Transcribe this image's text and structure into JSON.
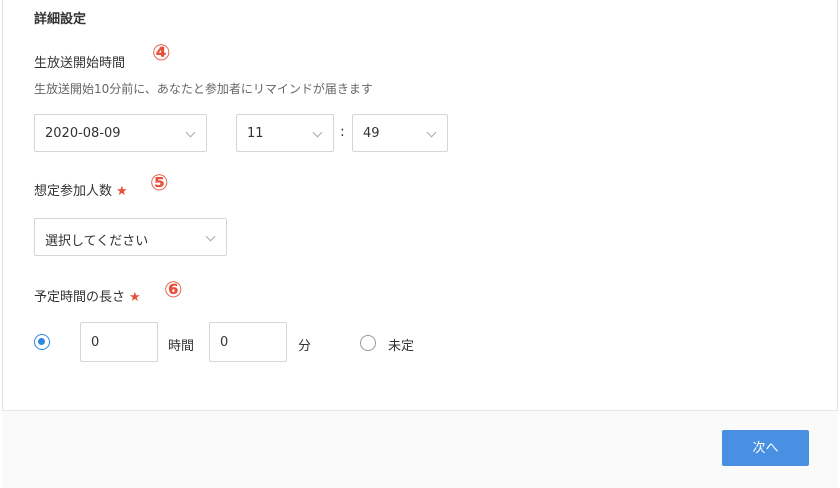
{
  "section": {
    "title": "詳細設定"
  },
  "start_time": {
    "label": "生放送開始時間",
    "marker": "④",
    "hint": "生放送開始10分前に、あなたと参加者にリマインドが届きます",
    "date": "2020-08-09",
    "hour": "11",
    "separator": ":",
    "minute": "49"
  },
  "participants": {
    "label": "想定参加人数",
    "required_mark": "★",
    "marker": "⑤",
    "selected": "選択してください"
  },
  "duration": {
    "label": "予定時間の長さ",
    "required_mark": "★",
    "marker": "⑥",
    "hours_value": "0",
    "hours_unit": "時間",
    "minutes_value": "0",
    "minutes_unit": "分",
    "undecided_label": "未定",
    "selected_option": "timed"
  },
  "footer": {
    "next_label": "次へ"
  },
  "colors": {
    "accent": "#4a90e2",
    "marker": "#e8503a"
  }
}
